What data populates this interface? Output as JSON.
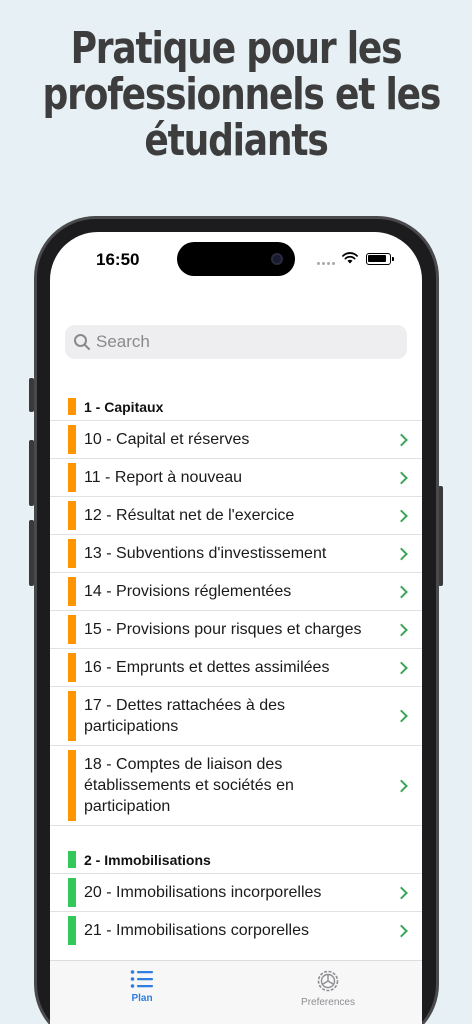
{
  "headline": {
    "line1": "Pratique pour les",
    "line2": "professionnels et les",
    "line3": "étudiants"
  },
  "status_bar": {
    "time": "16:50"
  },
  "search": {
    "placeholder": "Search"
  },
  "colors": {
    "section_1": "#ff9500",
    "section_2": "#34c759",
    "chevron": "#3aa65a",
    "tab_active": "#2f7de1"
  },
  "sections": [
    {
      "title": "1 - Capitaux",
      "color": "#ff9500",
      "items": [
        "10 - Capital et réserves",
        "11 - Report à nouveau",
        "12 - Résultat net de l'exercice",
        "13 - Subventions d'investissement",
        "14 - Provisions réglementées",
        "15 - Provisions pour risques et charges",
        "16 - Emprunts et dettes assimilées",
        "17 - Dettes rattachées à des participations",
        "18 - Comptes de liaison des établissements et sociétés en participation"
      ]
    },
    {
      "title": "2 - Immobilisations",
      "color": "#34c759",
      "items": [
        "20 - Immobilisations incorporelles",
        "21 - Immobilisations corporelles"
      ]
    }
  ],
  "tabbar": {
    "plan_label": "Plan",
    "preferences_label": "Preferences"
  }
}
